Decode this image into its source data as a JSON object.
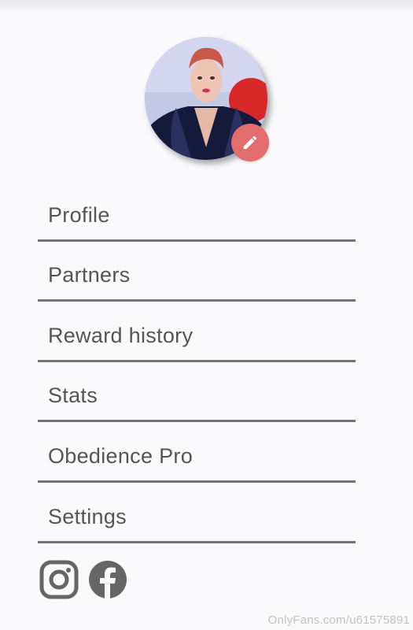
{
  "menu": {
    "items": [
      {
        "label": "Profile"
      },
      {
        "label": "Partners"
      },
      {
        "label": "Reward history"
      },
      {
        "label": "Stats"
      },
      {
        "label": "Obedience Pro"
      },
      {
        "label": "Settings"
      }
    ]
  },
  "profile": {
    "avatar_icon": "profile-photo",
    "edit_icon": "pencil-icon"
  },
  "social": {
    "icons": [
      "instagram-icon",
      "facebook-icon"
    ]
  },
  "watermark": "OnlyFans.com/u61575891",
  "colors": {
    "edit_button": "#e36c6c",
    "divider": "#737373",
    "menu_text": "#555555",
    "icon": "#666666"
  }
}
